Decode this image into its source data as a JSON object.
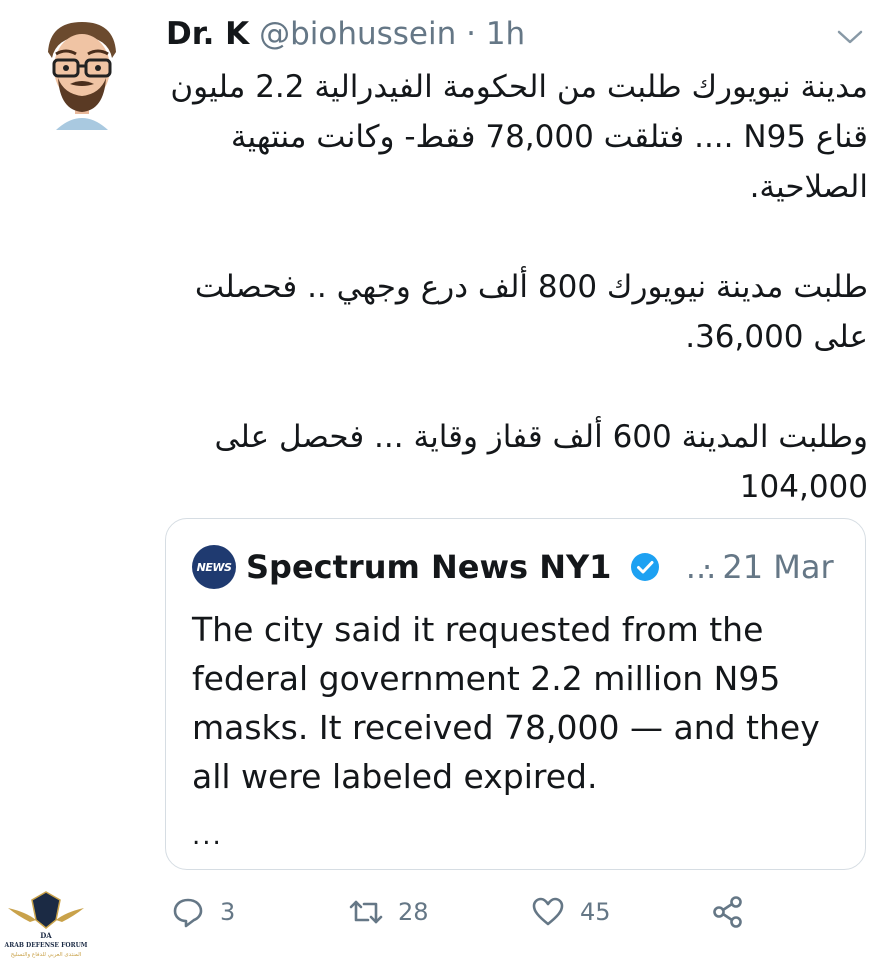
{
  "tweet": {
    "display_name": "Dr. K",
    "handle": "@biohussein",
    "separator": "·",
    "time": "1h",
    "paragraphs": [
      "مدينة نيويورك طلبت من الحكومة الفيدرالية 2.2 مليون قناع N95 .... فتلقت 78,000  فقط- وكانت منتهية الصلاحية.",
      "طلبت مدينة نيويورك 800 ألف درع وجهي .. فحصلت على 36,000.",
      "وطلبت المدينة 600 ألف قفاز وقاية ... فحصل على 104,000"
    ]
  },
  "quote": {
    "logo_text": "NEWS",
    "account_name": "Spectrum News NY1",
    "ellipsis": "...",
    "date": "· 21 Mar",
    "text": "The city said it requested from the federal government 2.2 million N95 masks. It received 78,000 — and they all were labeled expired.",
    "more": "..."
  },
  "actions": {
    "reply_count": "3",
    "retweet_count": "28",
    "like_count": "45"
  },
  "watermark": {
    "title": "ARAB DEFENSE FORUM",
    "subtitle": "المنتدى العربي للدفاع والتسليح",
    "mark": "DA"
  },
  "colors": {
    "text": "#14171a",
    "secondary": "#657786",
    "verified": "#1da1f2",
    "border": "#d6dde3"
  }
}
